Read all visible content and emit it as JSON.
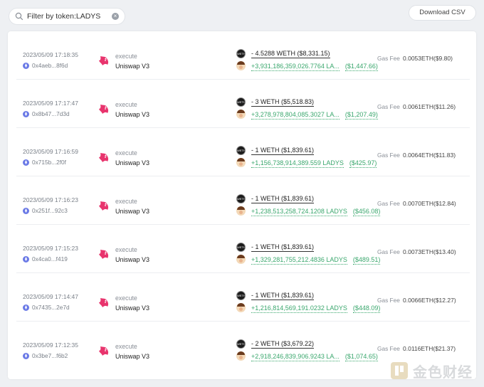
{
  "filter": {
    "text": "Filter by token:LADYS"
  },
  "toolbar": {
    "download_label": "Download CSV"
  },
  "rows": [
    {
      "time": "2023/05/09 17:18:35",
      "hash": "0x4aeb...8f6d",
      "action": "execute",
      "protocol": "Uniswap V3",
      "sent": "- 4.5288 WETH ($8,331.15)",
      "recv_amount": "+3,931,186,359,026.7764 LA...",
      "recv_usd": "($1,447.66)",
      "gas_label": "Gas Fee",
      "gas": "0.0053ETH($9.80)"
    },
    {
      "time": "2023/05/09 17:17:47",
      "hash": "0x8b47...7d3d",
      "action": "execute",
      "protocol": "Uniswap V3",
      "sent": "- 3 WETH ($5,518.83)",
      "recv_amount": "+3,278,978,804,085.3027 LA...",
      "recv_usd": "($1,207.49)",
      "gas_label": "Gas Fee",
      "gas": "0.0061ETH($11.26)"
    },
    {
      "time": "2023/05/09 17:16:59",
      "hash": "0x715b...2f0f",
      "action": "execute",
      "protocol": "Uniswap V3",
      "sent": "- 1 WETH ($1,839.61)",
      "recv_amount": "+1,156,738,914,389.559 LADYS",
      "recv_usd": "($425.97)",
      "gas_label": "Gas Fee",
      "gas": "0.0064ETH($11.83)"
    },
    {
      "time": "2023/05/09 17:16:23",
      "hash": "0x251f...92c3",
      "action": "execute",
      "protocol": "Uniswap V3",
      "sent": "- 1 WETH ($1,839.61)",
      "recv_amount": "+1,238,513,258,724.1208 LADYS",
      "recv_usd": "($456.08)",
      "gas_label": "Gas Fee",
      "gas": "0.0070ETH($12.84)"
    },
    {
      "time": "2023/05/09 17:15:23",
      "hash": "0x4ca0...f419",
      "action": "execute",
      "protocol": "Uniswap V3",
      "sent": "- 1 WETH ($1,839.61)",
      "recv_amount": "+1,329,281,755,212.4836 LADYS",
      "recv_usd": "($489.51)",
      "gas_label": "Gas Fee",
      "gas": "0.0073ETH($13.40)"
    },
    {
      "time": "2023/05/09 17:14:47",
      "hash": "0x7435...2e7d",
      "action": "execute",
      "protocol": "Uniswap V3",
      "sent": "- 1 WETH ($1,839.61)",
      "recv_amount": "+1,216,814,569,191.0232 LADYS",
      "recv_usd": "($448.09)",
      "gas_label": "Gas Fee",
      "gas": "0.0066ETH($12.27)"
    },
    {
      "time": "2023/05/09 17:12:35",
      "hash": "0x3be7...f6b2",
      "action": "execute",
      "protocol": "Uniswap V3",
      "sent": "- 2 WETH ($3,679.22)",
      "recv_amount": "+2,918,246,839,906.9243 LA...",
      "recv_usd": "($1,074.65)",
      "gas_label": "Gas Fee",
      "gas": "0.0116ETH($21.37)"
    }
  ],
  "icons": {
    "token_sent": "weth-token-icon",
    "token_received": "ladys-token-icon",
    "protocol": "uniswap-unicorn-icon",
    "chain": "ethereum-icon"
  },
  "watermark": {
    "text": "金色财经"
  },
  "colors": {
    "positive": "#3aa76d",
    "eth": "#6b7ae6",
    "uniswap": "#e8346d"
  }
}
